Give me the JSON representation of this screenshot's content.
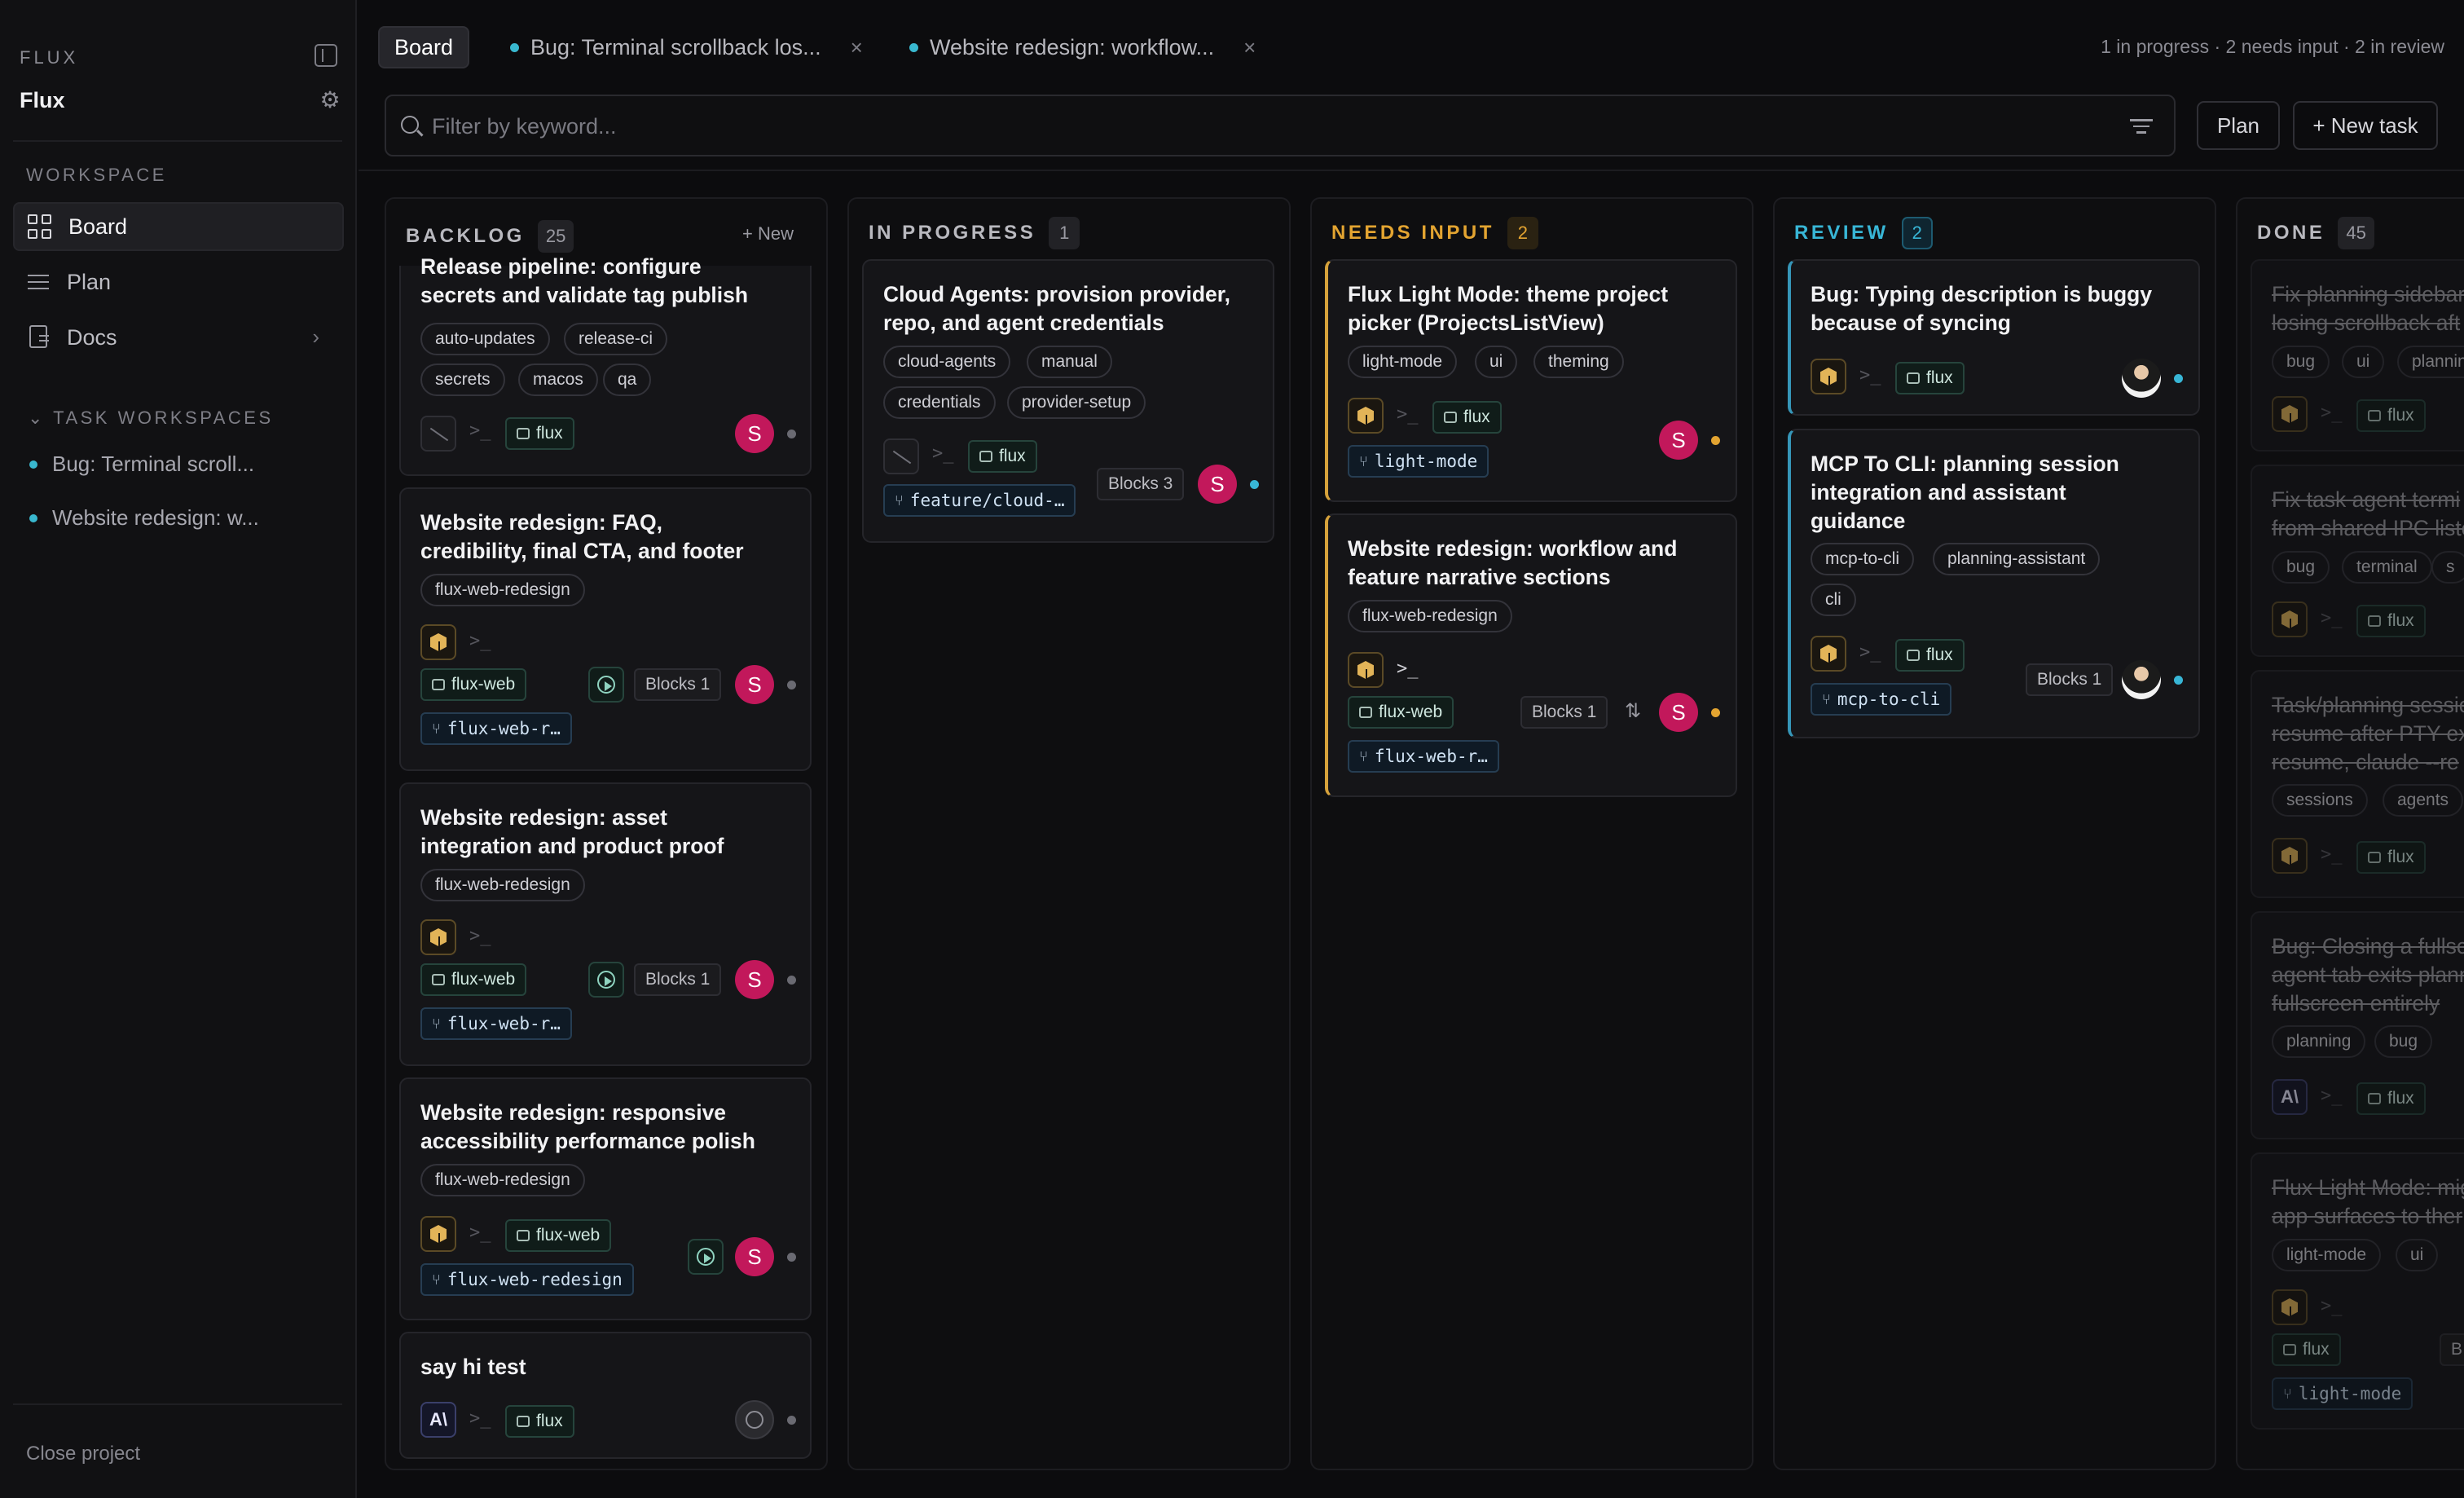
{
  "sidebar": {
    "brand_small": "FLUX",
    "brand": "Flux",
    "workspace_label": "WORKSPACE",
    "nav": [
      {
        "label": "Board",
        "icon": "board-icon",
        "active": true
      },
      {
        "label": "Plan",
        "icon": "list-icon"
      },
      {
        "label": "Docs",
        "icon": "doc-icon"
      }
    ],
    "task_ws_label": "TASK WORKSPACES",
    "task_workspaces": [
      "Bug: Terminal scroll...",
      "Website redesign: w..."
    ],
    "close_project": "Close project"
  },
  "header": {
    "tabs": [
      {
        "label": "Board"
      },
      {
        "label": "Bug: Terminal scrollback los...",
        "close": "×"
      },
      {
        "label": "Website redesign: workflow...",
        "close": "×"
      }
    ],
    "status_summary": "1 in progress · 2 needs input · 2 in review",
    "filter_placeholder": "Filter by keyword...",
    "plan_button": "Plan",
    "new_task_button": "+ New task"
  },
  "colors": {
    "in_progress": "#9a9aa2",
    "needs_input": "#e3a431",
    "review": "#38b6d6",
    "avatar": "#c2185b"
  },
  "columns": [
    {
      "title": "BACKLOG",
      "count": "25",
      "new": "+ New",
      "color": "#b9b9bf",
      "cards": [
        {
          "title": "Release pipeline: configure\nsecrets and validate tag publish",
          "tags": [
            "auto-updates",
            "release-ci",
            "secrets",
            "macos",
            "qa"
          ],
          "repo": "flux",
          "avatar": "S"
        },
        {
          "title": "Website redesign: FAQ,\ncredibility, final CTA, and footer",
          "tags": [
            "flux-web-redesign"
          ],
          "repo": "flux-web",
          "branch": "flux-web-r…",
          "blocks": "Blocks 1",
          "avatar": "S"
        },
        {
          "title": "Website redesign: asset\nintegration and product proof",
          "tags": [
            "flux-web-redesign"
          ],
          "repo": "flux-web",
          "branch": "flux-web-r…",
          "blocks": "Blocks 1",
          "avatar": "S"
        },
        {
          "title": "Website redesign: responsive\naccessibility performance polish",
          "tags": [
            "flux-web-redesign"
          ],
          "repo": "flux-web",
          "branch": "flux-web-redesign",
          "avatar": "S"
        },
        {
          "title": "say hi test",
          "tags": [],
          "agent": "A\\",
          "repo": "flux"
        }
      ]
    },
    {
      "title": "IN PROGRESS",
      "count": "1",
      "color": "#b9b9bf",
      "cards": [
        {
          "title": "Cloud Agents: provision provider,\nrepo, and agent credentials",
          "tags": [
            "cloud-agents",
            "manual",
            "credentials",
            "provider-setup"
          ],
          "repo": "flux",
          "branch": "feature/cloud-…",
          "blocks": "Blocks 3",
          "avatar": "S"
        }
      ]
    },
    {
      "title": "NEEDS INPUT",
      "count": "2",
      "color": "#e3a431",
      "cards": [
        {
          "title": "Flux Light Mode: theme project\npicker (ProjectsListView)",
          "tags": [
            "light-mode",
            "ui",
            "theming"
          ],
          "repo": "flux",
          "branch": "light-mode",
          "avatar": "S"
        },
        {
          "title": "Website redesign: workflow and\nfeature narrative sections",
          "tags": [
            "flux-web-redesign"
          ],
          "repo": "flux-web",
          "branch": "flux-web-r…",
          "blocks": "Blocks 1",
          "avatar": "S"
        }
      ]
    },
    {
      "title": "REVIEW",
      "count": "2",
      "color": "#38b6d6",
      "cards": [
        {
          "title": "Bug: Typing description is buggy\nbecause of syncing",
          "tags": [],
          "repo": "flux"
        },
        {
          "title": "MCP To CLI: planning session\nintegration and assistant\nguidance",
          "tags": [
            "mcp-to-cli",
            "planning-assistant",
            "cli"
          ],
          "repo": "flux",
          "branch": "mcp-to-cli",
          "blocks": "Blocks 1"
        }
      ]
    },
    {
      "title": "DONE",
      "count": "45",
      "color": "#b9b9bf",
      "cards": [
        {
          "title": "Fix planning sidebar\nlosing scrollback aft",
          "tags": [
            "bug",
            "ui",
            "planning"
          ],
          "repo": "flux"
        },
        {
          "title": "Fix task agent termi\nfrom shared IPC liste",
          "tags": [
            "bug",
            "terminal",
            "s"
          ],
          "repo": "flux"
        },
        {
          "title": "Task/planning sessio\nresume after PTY ex\nresume, claude --re",
          "tags": [
            "sessions",
            "agents"
          ],
          "repo": "flux"
        },
        {
          "title": "Bug: Closing a fullsc\nagent tab exits plann\nfullscreen entirely",
          "tags": [
            "planning",
            "bug"
          ],
          "agent": "A\\",
          "repo": "flux"
        },
        {
          "title": "Flux Light Mode: mig\napp surfaces to ther",
          "tags": [
            "light-mode",
            "ui"
          ],
          "repo": "flux",
          "extra": "B",
          "branch": "light-mode"
        }
      ]
    }
  ]
}
